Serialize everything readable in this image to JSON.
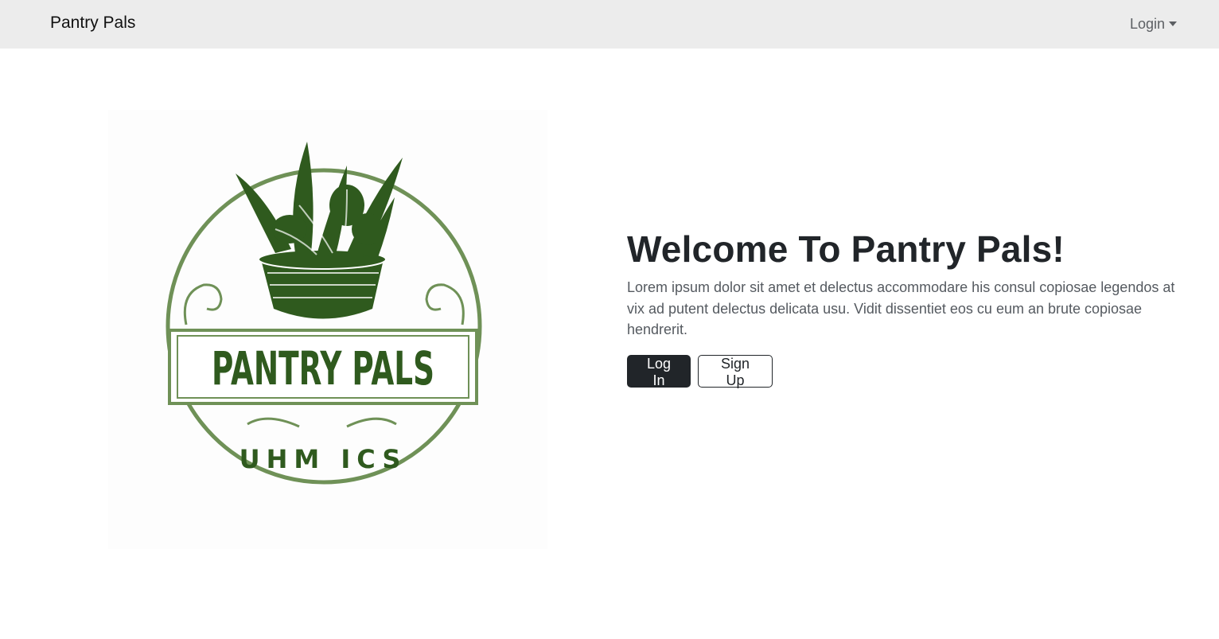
{
  "navbar": {
    "brand": "Pantry Pals",
    "login_dropdown": "Login"
  },
  "logo": {
    "icon": "vegetable-basket-logo",
    "title": "PANTRY PALS",
    "subtitle": "UHM ICS",
    "colors": {
      "dark_green": "#2f5a1e",
      "light_green": "#6f9157"
    }
  },
  "hero": {
    "title": "Welcome To Pantry Pals!",
    "description": "Lorem ipsum dolor sit amet et delectus accommodare his consul copiosae legendos at vix ad putent delectus delicata usu. Vidit dissentiet eos cu eum an brute copiosae hendrerit.",
    "login_button": "Log In",
    "signup_button": "Sign Up"
  },
  "colors": {
    "navbar_bg": "#ececec",
    "button_dark": "#212529"
  }
}
